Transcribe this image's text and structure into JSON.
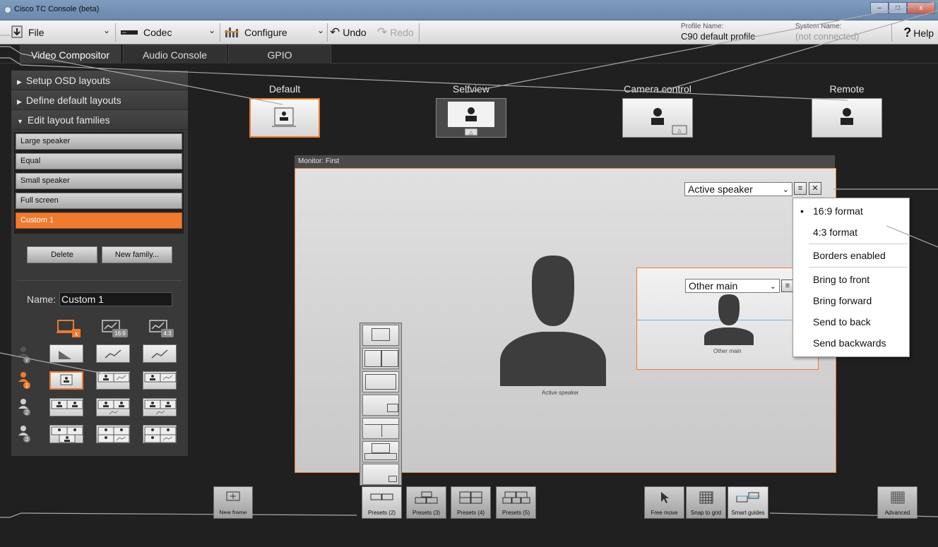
{
  "window": {
    "title": "Cisco TC Console (beta)",
    "buttons": [
      "–",
      "□",
      "x"
    ]
  },
  "toolbar": {
    "file": "File",
    "codec": "Codec",
    "configure": "Configure",
    "undo": "Undo",
    "redo": "Redo",
    "profile_label": "Profile Name:",
    "profile_value": "C90 default profile",
    "system_label": "System Name:",
    "system_value": "(not connected)",
    "help": "Help"
  },
  "tabs": [
    {
      "label": "Video Compositor",
      "active": true
    },
    {
      "label": "Audio Console",
      "active": false
    },
    {
      "label": "GPIO",
      "active": false
    }
  ],
  "sidebar": {
    "sections": [
      {
        "label": "Setup OSD layouts",
        "expanded": false
      },
      {
        "label": "Define default layouts",
        "expanded": false
      },
      {
        "label": "Edit layout families",
        "expanded": true
      }
    ],
    "families": [
      "Large speaker",
      "Equal",
      "Small speaker",
      "Full screen",
      "Custom 1"
    ],
    "selected_family": "Custom 1",
    "delete_label": "Delete",
    "new_family_label": "New family...",
    "name_label": "Name:",
    "name_value": "Custom 1",
    "column_badges": [
      "x",
      "16:9",
      "4:3"
    ],
    "row_badges": [
      "x",
      "1",
      "2",
      "3"
    ]
  },
  "layouts_top": [
    {
      "label": "Default",
      "selected": true
    },
    {
      "label": "Selfview",
      "selected": false
    },
    {
      "label": "Camera control",
      "selected": false
    },
    {
      "label": "Remote",
      "selected": false
    }
  ],
  "monitor": {
    "title": "Monitor: First",
    "main_select": "Active speaker",
    "main_caption": "Active speaker",
    "sub_select": "Other main",
    "sub_caption": "Other main"
  },
  "context_menu": {
    "items": [
      "16:9 format",
      "4:3 format",
      "Borders enabled",
      "Bring to front",
      "Bring forward",
      "Send to back",
      "Send backwards"
    ],
    "checked": "16:9 format"
  },
  "bottom_toolbar": {
    "new_frame": "New frame",
    "presets": [
      "Presets (2)",
      "Presets (3)",
      "Presets (4)",
      "Presets (5)"
    ],
    "free_move": "Free move",
    "snap_to_grid": "Snap to grid",
    "smart_guides": "Smart guides",
    "advanced": "Advanced"
  },
  "colors": {
    "accent": "#f07a2e",
    "panel": "#393939",
    "background": "#202020"
  }
}
